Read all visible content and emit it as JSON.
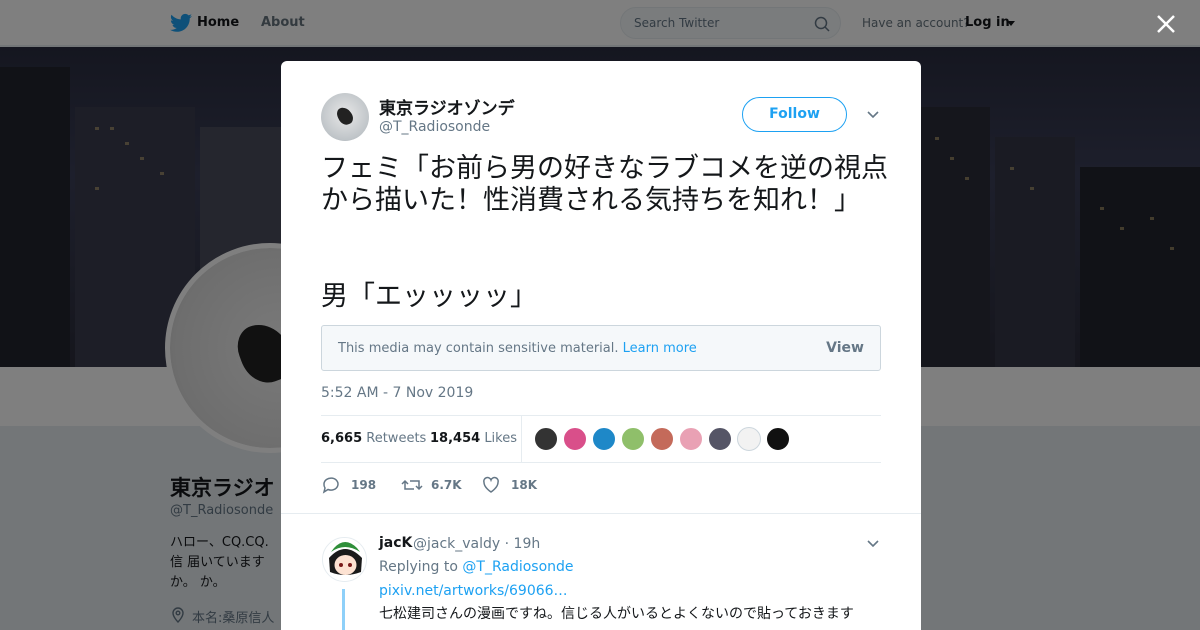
{
  "nav": {
    "home": "Home",
    "about": "About",
    "search_placeholder": "Search Twitter",
    "have_account": "Have an account?",
    "login": "Log in"
  },
  "profile": {
    "name": "東京ラジオ",
    "handle": "@T_Radiosonde",
    "bio": "ハロー、CQ.CQ.信 届いていますか。 か。",
    "location": "本名:桑原信人"
  },
  "tweet": {
    "author_name": "東京ラジオゾンデ",
    "author_handle": "@T_Radiosonde",
    "follow_label": "Follow",
    "text": "フェミ「お前ら男の好きなラブコメを逆の視点から描いた！性消費される気持ちを知れ！」",
    "text2": "男「エッッッッ」",
    "sensitive_text": "This media may contain sensitive material.",
    "sensitive_learn": "Learn more",
    "sensitive_view": "View",
    "timestamp": "5:52 AM - 7 Nov 2019",
    "retweets_count": "6,665",
    "retweets_label": "Retweets",
    "likes_count": "18,454",
    "likes_label": "Likes",
    "reply_count": "198",
    "retweet_count_short": "6.7K",
    "like_count_short": "18K",
    "likers_colors": [
      "#333333",
      "#d94f8a",
      "#1e88c8",
      "#8fbf6a",
      "#c46a5a",
      "#e9a1b4",
      "#555566",
      "#f2f2f2",
      "#111111"
    ]
  },
  "reply": {
    "name": "jacK",
    "meta": "@jack_valdy · 19h",
    "replying_to_label": "Replying to",
    "replying_to_handle": "@T_Radiosonde",
    "link": "pixiv.net/artworks/69066…",
    "body": "七松建司さんの漫画ですね。信じる人がいるとよくないので貼っておきます"
  },
  "colors": {
    "accent": "#1da1f2",
    "muted": "#657786",
    "text": "#14171a"
  }
}
